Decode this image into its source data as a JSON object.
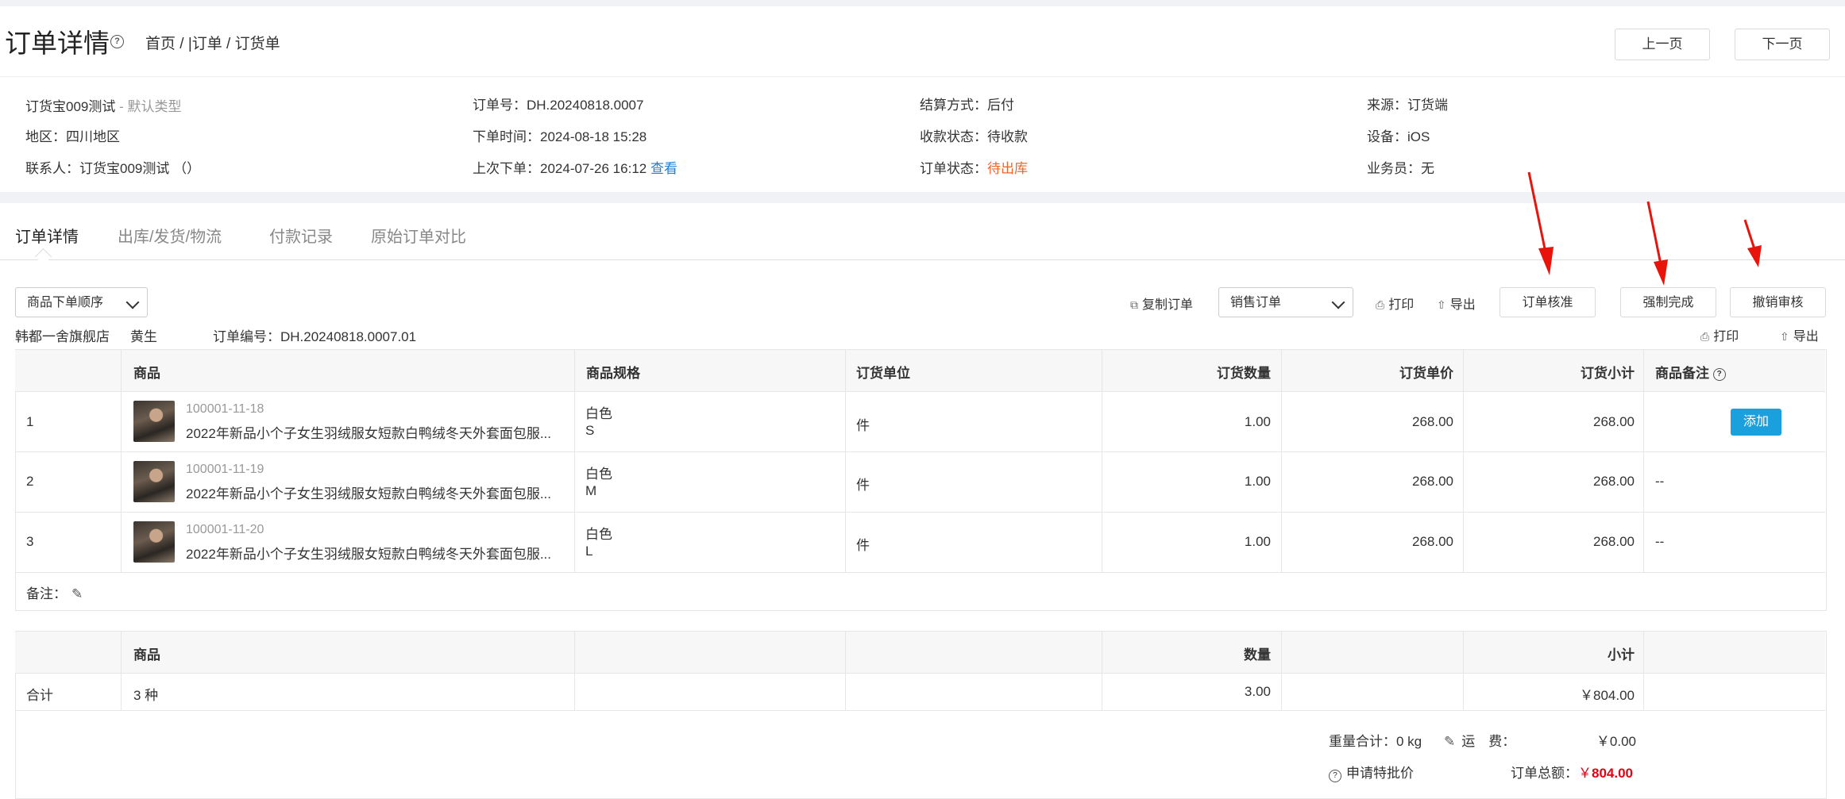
{
  "header": {
    "title": "订单详情",
    "breadcrumb": "首页 / |订单 / 订货单",
    "prev_label": "上一页",
    "next_label": "下一页"
  },
  "info": {
    "customer": "订货宝009测试",
    "customer_type": " - 默认类型",
    "region": "地区：四川地区",
    "contact": "联系人：订货宝009测试 （）",
    "order_no": "订单号：DH.20240818.0007",
    "order_time": "下单时间：2024-08-18 15:28",
    "last_order": "上次下单：2024-07-26 16:12 ",
    "last_order_link": "查看",
    "settlement": "结算方式：后付",
    "payment_status": "收款状态：待收款",
    "order_status_label": "订单状态：",
    "order_status_value": "待出库",
    "source": "来源：订货端",
    "device": "设备：iOS",
    "salesman": "业务员：无"
  },
  "tabs": [
    "订单详情",
    "出库/发货/物流",
    "付款记录",
    "原始订单对比"
  ],
  "toolbar": {
    "sort_select": "商品下单顺序",
    "copy_order": "复制订单",
    "order_type_select": "销售订单",
    "print": "打印",
    "export": "导出",
    "approve": "订单核准",
    "force_complete": "强制完成",
    "revoke_review": "撤销审核"
  },
  "meta": {
    "shop": "韩都一舍旗舰店",
    "person": "黄生",
    "order_code": "订单编号：DH.20240818.0007.01",
    "print": "打印",
    "export": "导出"
  },
  "table": {
    "headers": [
      "商品",
      "商品规格",
      "订货单位",
      "订货数量",
      "订货单价",
      "订货小计",
      "商品备注"
    ],
    "rows": [
      {
        "idx": "1",
        "code": "100001-11-18",
        "name": "2022年新品小个子女生羽绒服女短款白鸭绒冬天外套面包服...",
        "color": "白色",
        "size": "S",
        "unit": "件",
        "qty": "1.00",
        "price": "268.00",
        "subtotal": "268.00",
        "remark": ""
      },
      {
        "idx": "2",
        "code": "100001-11-19",
        "name": "2022年新品小个子女生羽绒服女短款白鸭绒冬天外套面包服...",
        "color": "白色",
        "size": "M",
        "unit": "件",
        "qty": "1.00",
        "price": "268.00",
        "subtotal": "268.00",
        "remark": "--"
      },
      {
        "idx": "3",
        "code": "100001-11-20",
        "name": "2022年新品小个子女生羽绒服女短款白鸭绒冬天外套面包服...",
        "color": "白色",
        "size": "L",
        "unit": "件",
        "qty": "1.00",
        "price": "268.00",
        "subtotal": "268.00",
        "remark": "--"
      }
    ],
    "add_label": "添加",
    "note_label": "备注："
  },
  "summary": {
    "headers": {
      "goods": "商品",
      "qty": "数量",
      "subtotal": "小计"
    },
    "total_label": "合计",
    "kinds": "3 种",
    "qty": "3.00",
    "subtotal": "￥804.00",
    "weight": "重量合计：0 kg",
    "freight_label": "运　费：",
    "freight": "￥0.00",
    "special_price": "申请特批价",
    "total_amount_label": "订单总额：",
    "total_amount_currency": "￥",
    "total_amount": "804.00"
  },
  "colors": {
    "accent_blue": "#1aa0dc",
    "status_orange": "#f0642c",
    "total_red": "#e60012",
    "arrow_red": "#e8140c"
  }
}
